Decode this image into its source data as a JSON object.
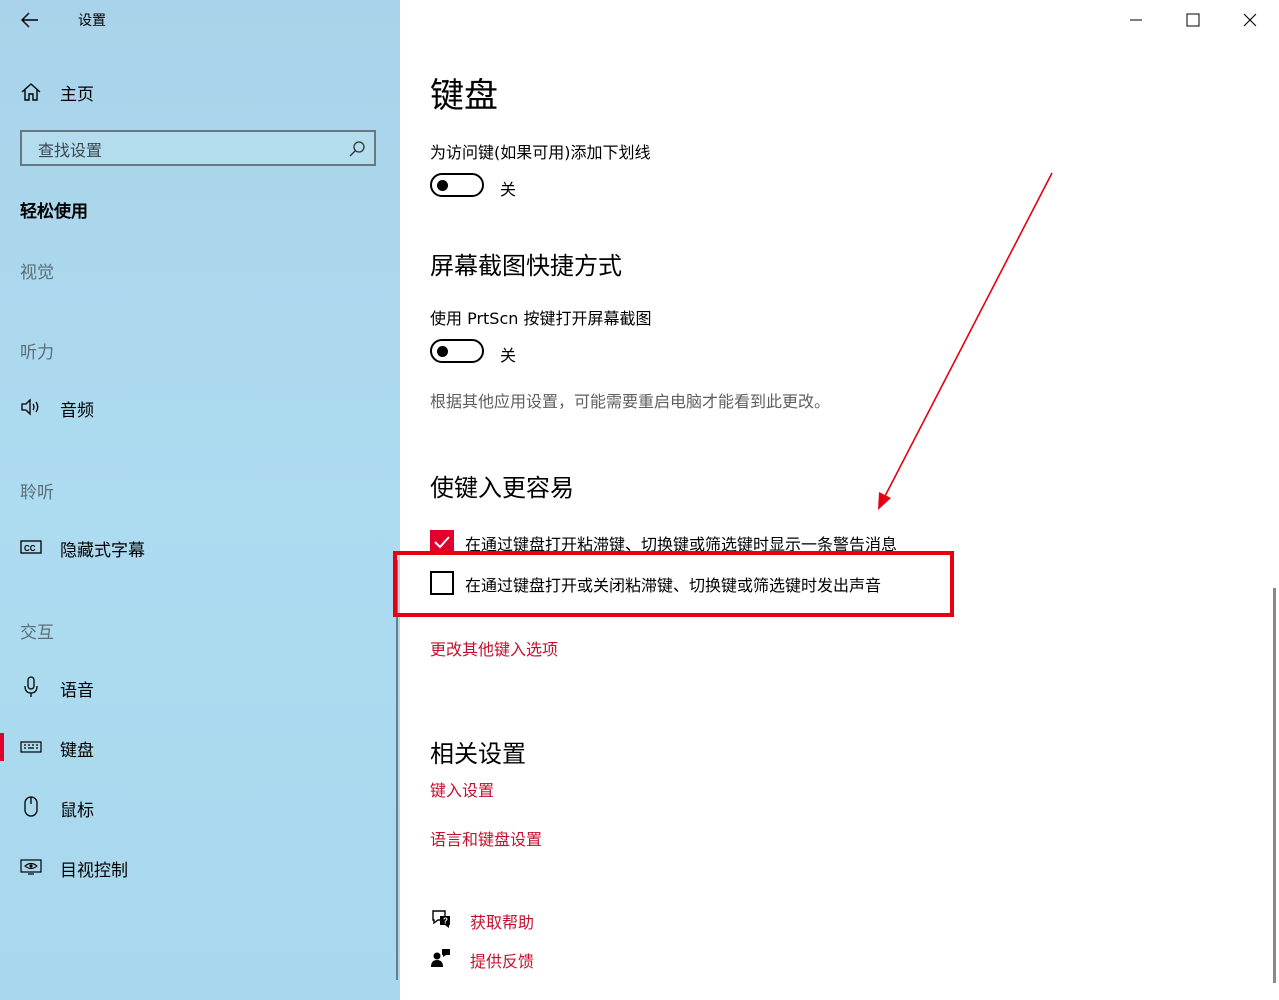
{
  "window": {
    "title": "设置"
  },
  "sidebar": {
    "home_label": "主页",
    "search_placeholder": "查找设置",
    "section_title": "轻松使用",
    "categories": {
      "vision": "视觉",
      "hearing": "听力",
      "listening": "聆听",
      "interaction": "交互"
    },
    "items": {
      "audio": "音频",
      "captions": "隐藏式字幕",
      "speech": "语音",
      "keyboard": "键盘",
      "mouse": "鼠标",
      "eye_control": "目视控制"
    },
    "active_item": "键盘"
  },
  "main": {
    "page_title": "键盘",
    "underline_access_keys": {
      "label": "为访问键(如果可用)添加下划线",
      "state": "关",
      "on": false
    },
    "print_screen": {
      "heading": "屏幕截图快捷方式",
      "label": "使用 PrtScn 按键打开屏幕截图",
      "state": "关",
      "on": false,
      "note": "根据其他应用设置，可能需要重启电脑才能看到此更改。"
    },
    "typing": {
      "heading": "使键入更容易",
      "checkbox_warning": {
        "label": "在通过键盘打开粘滞键、切换键或筛选键时显示一条警告消息",
        "checked": true
      },
      "checkbox_sound": {
        "label": "在通过键盘打开或关闭粘滞键、切换键或筛选键时发出声音",
        "checked": false
      },
      "more_options_link": "更改其他键入选项"
    },
    "related": {
      "heading": "相关设置",
      "typing_settings_link": "键入设置",
      "language_keyboard_link": "语言和键盘设置"
    },
    "help": {
      "get_help": "获取帮助",
      "feedback": "提供反馈"
    }
  },
  "colors": {
    "accent": "#e0002b",
    "link": "#c4112e",
    "annotation": "#e60012"
  }
}
